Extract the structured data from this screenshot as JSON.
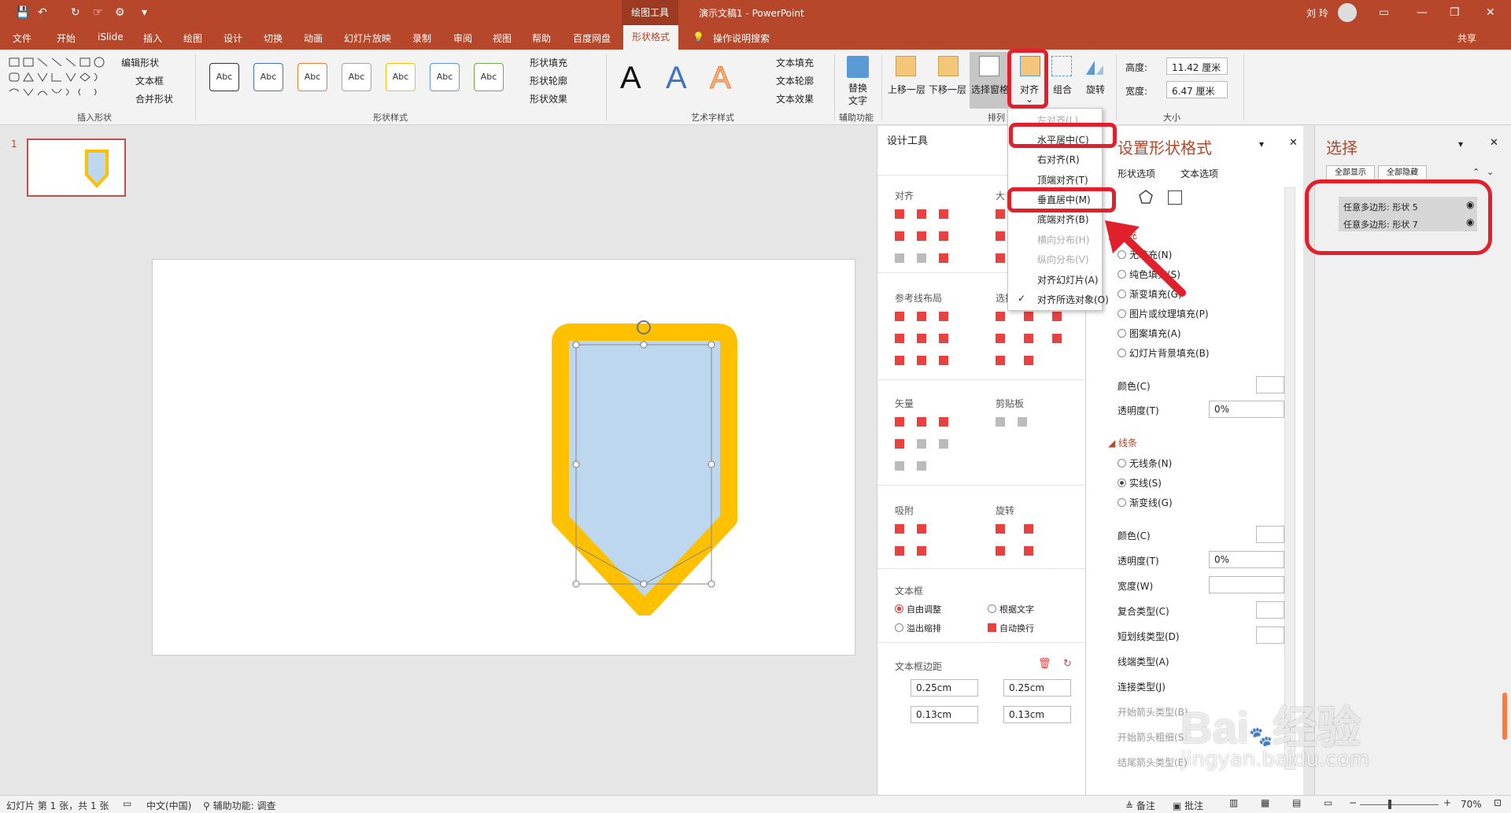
{
  "app": {
    "title": "演示文稿1 - PowerPoint",
    "context_tab_group": "绘图工具",
    "user": "刘 玲",
    "share": "共享"
  },
  "tabs": [
    "文件",
    "开始",
    "iSlide",
    "插入",
    "绘图",
    "设计",
    "切换",
    "动画",
    "幻灯片放映",
    "录制",
    "审阅",
    "视图",
    "帮助",
    "百度网盘",
    "形状格式"
  ],
  "tell_me": "操作说明搜索",
  "ribbon": {
    "insert_shapes": {
      "label": "插入形状",
      "edit_shape": "编辑形状",
      "text_box": "文本框",
      "merge_shapes": "合并形状"
    },
    "shape_styles": {
      "label": "形状样式",
      "sample": "Abc",
      "fill": "形状填充",
      "outline": "形状轮廓",
      "effects": "形状效果",
      "colors": [
        "#333333",
        "#4472c4",
        "#ed7d31",
        "#a5a5a5",
        "#ffc000",
        "#5b9bd5",
        "#70ad47"
      ]
    },
    "wordart": {
      "label": "艺术字样式",
      "letter": "A",
      "text_fill": "文本填充",
      "text_outline": "文本轮廓",
      "text_effects": "文本效果"
    },
    "accessibility": {
      "label": "辅助功能",
      "alt_text_line1": "替换",
      "alt_text_line2": "文字"
    },
    "arrange": {
      "label": "排列",
      "bring_forward": "上移一层",
      "send_backward": "下移一层",
      "selection_pane": "选择窗格",
      "align": "对齐",
      "group": "组合",
      "rotate": "旋转"
    },
    "size": {
      "label": "大小",
      "height_label": "高度:",
      "height_value": "11.42 厘米",
      "width_label": "宽度:",
      "width_value": "6.47 厘米"
    }
  },
  "align_menu": [
    {
      "label": "左对齐(L)",
      "disabled": true
    },
    {
      "label": "水平居中(C)",
      "highlight": true
    },
    {
      "label": "右对齐(R)"
    },
    {
      "label": "顶端对齐(T)"
    },
    {
      "label": "垂直居中(M)",
      "highlight": true
    },
    {
      "label": "底端对齐(B)"
    },
    {
      "label": "横向分布(H)",
      "disabled": true
    },
    {
      "label": "纵向分布(V)",
      "disabled": true
    },
    {
      "label": "对齐幻灯片(A)"
    },
    {
      "label": "对齐所选对象(O)",
      "checked": true
    }
  ],
  "thumbnails": {
    "slide_number": "1"
  },
  "design_tools": {
    "title": "设计工具",
    "align": "对齐",
    "size_abbr": "大",
    "guide_layout": "参考线布局",
    "select_abbr": "选择",
    "vector": "矢量",
    "clipboard": "剪贴板",
    "snap": "吸附",
    "rotate": "旋转",
    "textbox": {
      "label": "文本框",
      "autofit": "自由调整",
      "shrink": "根据文字",
      "overflow": "溢出缩排",
      "wrap": "自动换行"
    },
    "margins": {
      "label": "文本框边距",
      "left": "0.25cm",
      "right": "0.25cm",
      "top": "0.13cm",
      "bottom": "0.13cm"
    }
  },
  "format_pane": {
    "title": "设置形状格式",
    "tab_shape": "形状选项",
    "tab_text": "文本选项",
    "fill_header": "填充",
    "fill_options": [
      "无填充(N)",
      "纯色填充(S)",
      "渐变填充(G)",
      "图片或纹理填充(P)",
      "图案填充(A)",
      "幻灯片背景填充(B)"
    ],
    "color": "颜色(C)",
    "transparency": "透明度(T)",
    "transparency_value": "0%",
    "line_header": "线条",
    "line_options": [
      "无线条(N)",
      "实线(S)",
      "渐变线(G)"
    ],
    "line_color": "颜色(C)",
    "line_transparency": "透明度(T)",
    "line_transparency_value": "0%",
    "width": "宽度(W)",
    "compound": "复合类型(C)",
    "dash": "短划线类型(D)",
    "cap": "线端类型(A)",
    "join": "连接类型(J)",
    "begin_arrow_type": "开始箭头类型(B)",
    "begin_arrow_size": "开始箭头粗细(S)",
    "end_arrow_type": "结尾箭头类型(E)"
  },
  "selection_pane": {
    "title": "选择",
    "show_all": "全部显示",
    "hide_all": "全部隐藏",
    "items": [
      "任意多边形: 形状 5",
      "任意多边形: 形状 7"
    ]
  },
  "status": {
    "slide_info": "幻灯片 第 1 张，共 1 张",
    "language": "中文(中国)",
    "accessibility": "辅助功能: 调查",
    "notes": "备注",
    "comments": "批注",
    "zoom": "70%"
  },
  "watermark": {
    "brand": "Bai",
    "brand_cn": "经验",
    "url": "jingyan.baidu.com"
  },
  "colors": {
    "accent": "#b7472a",
    "highlight": "#e0202a",
    "shape_outline": "#ffc000",
    "shape_fill": "#bdd7ee"
  }
}
